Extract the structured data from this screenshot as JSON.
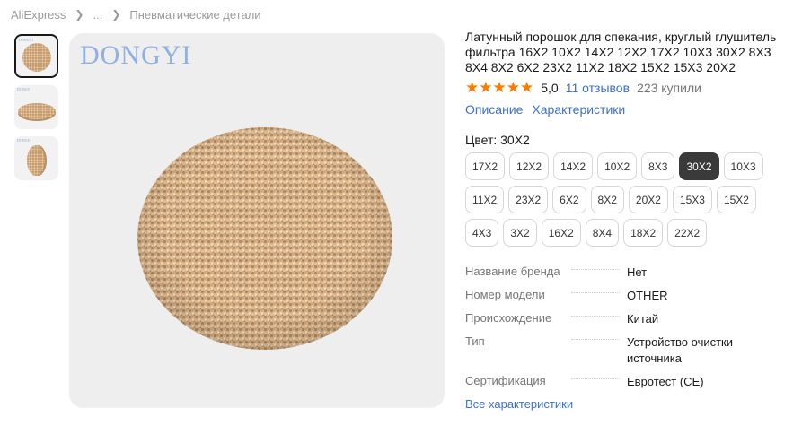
{
  "breadcrumb": {
    "items": [
      "AliExpress",
      "...",
      "Пневматические детали"
    ]
  },
  "gallery": {
    "logo_text": "DONGYI",
    "thumb_logo_text": "DONGYI",
    "thumbnails": [
      "disk-front",
      "disk-tilted",
      "disk-side"
    ],
    "active_index": 0
  },
  "product": {
    "title": "Латунный порошок для спекания, круглый глушитель фильтра 16X2 10X2 14X2 12X2 17X2 10X3 30X2 8X3 8X4 8X2 6X2 23X2 11X2 18X2 15X2 15X3 20X2",
    "rating": {
      "value": "5,0",
      "stars": 5,
      "reviews": "11 отзывов",
      "sold": "223 купили"
    },
    "tabs": [
      "Описание",
      "Характеристики"
    ],
    "color_label": "Цвет: 30X2",
    "variants": [
      "17X2",
      "12X2",
      "14X2",
      "10X2",
      "8X3",
      "30X2",
      "10X3",
      "11X2",
      "23X2",
      "6X2",
      "8X2",
      "20X2",
      "15X3",
      "15X2",
      "4X3",
      "3X2",
      "16X2",
      "8X4",
      "18X2",
      "22X2"
    ],
    "selected_variant": "30X2"
  },
  "specs": {
    "rows": [
      {
        "key": "Название бренда",
        "value": "Нет"
      },
      {
        "key": "Номер модели",
        "value": "OTHER"
      },
      {
        "key": "Происхождение",
        "value": "Китай"
      },
      {
        "key": "Тип",
        "value": "Устройство очистки источника"
      },
      {
        "key": "Сертификация",
        "value": "Евротест (CE)"
      }
    ],
    "all_link": "Все характеристики"
  },
  "colors": {
    "link": "#3d6fc9",
    "star": "#ff7a00",
    "selected_variant_bg": "#3a3a3a",
    "image_bg": "#eeeeee",
    "disk_base": "#d7b48c"
  }
}
